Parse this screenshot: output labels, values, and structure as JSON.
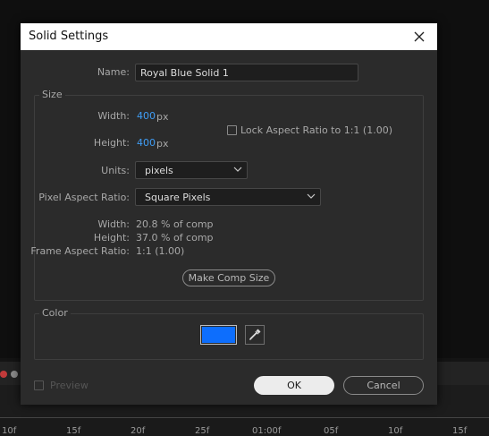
{
  "dialog": {
    "title": "Solid Settings",
    "name_label": "Name:",
    "name_value": "Royal Blue Solid 1"
  },
  "size": {
    "legend": "Size",
    "width_label": "Width:",
    "width_value": "400",
    "height_label": "Height:",
    "height_value": "400",
    "unit": "px",
    "lock_label": "Lock Aspect Ratio to 1:1 (1.00)",
    "lock_checked": false,
    "units_label": "Units:",
    "units_value": "pixels",
    "par_label": "Pixel Aspect Ratio:",
    "par_value": "Square Pixels",
    "info_width_label": "Width:",
    "info_width_value": "20.8 % of comp",
    "info_height_label": "Height:",
    "info_height_value": "37.0 % of comp",
    "info_far_label": "Frame Aspect Ratio:",
    "info_far_value": "1:1 (1.00)",
    "make_comp_size": "Make Comp Size"
  },
  "color": {
    "legend": "Color",
    "swatch": "#0d6efd"
  },
  "footer": {
    "preview_label": "Preview",
    "preview_checked": false,
    "ok": "OK",
    "cancel": "Cancel"
  },
  "timeline": {
    "ticks": [
      "10f",
      "15f",
      "20f",
      "25f",
      "01:00f",
      "05f",
      "10f",
      "15f"
    ]
  },
  "colors": {
    "accent_value": "#3f9df5",
    "dialog_bg": "#2b2b2b"
  }
}
